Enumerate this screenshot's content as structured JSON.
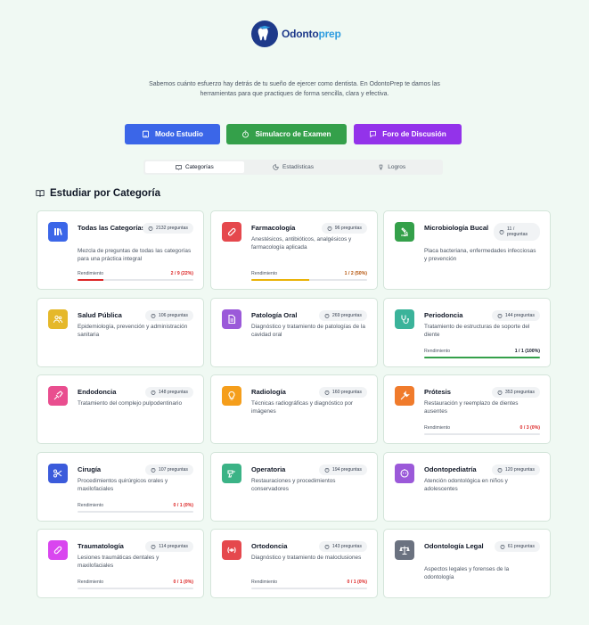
{
  "brand": {
    "name_main": "Odonto",
    "name_accent": "prep"
  },
  "tagline": "Sabemos cuánto esfuerzo hay detrás de tu sueño de ejercer como dentista. En OdontoPrep te damos las herramientas para que practiques de forma sencilla, clara y efectiva.",
  "modes": {
    "study": "Modo Estudio",
    "exam": "Simulacro de Examen",
    "forum": "Foro de Discusión"
  },
  "tabs": [
    {
      "label": "Categorías",
      "icon": "book-icon",
      "active": true
    },
    {
      "label": "Estadísticas",
      "icon": "chart-icon",
      "active": false
    },
    {
      "label": "Logros",
      "icon": "trophy-icon",
      "active": false
    }
  ],
  "section_title": "Estudiar por Categoría",
  "perf_label": "Rendimiento",
  "categories": [
    {
      "title": "Todas las Categorías",
      "badge": "2132 preguntas",
      "desc": "Mezcla de preguntas de todas las categorías para una práctica integral",
      "color": "#3b66e8",
      "icon": "library-icon",
      "perf": "2 / 9 (22%)",
      "pct": 22,
      "perf_color": "#dc2626",
      "bar_color": "#dc2626"
    },
    {
      "title": "Farmacología",
      "badge": "96 preguntas",
      "desc": "Anestésicos, antibióticos, analgésicos y farmacología aplicada",
      "color": "#e5484d",
      "icon": "pill-icon",
      "perf": "1 / 2 (50%)",
      "pct": 50,
      "perf_color": "#b45309",
      "bar_color": "#eab308"
    },
    {
      "title": "Microbiología Bucal",
      "badge": "11 / preguntas",
      "desc": "Placa bacteriana, enfermedades infecciosas y prevención",
      "color": "#34a04a",
      "icon": "microscope-icon"
    },
    {
      "title": "Salud Pública",
      "badge": "106 preguntas",
      "desc": "Epidemiología, prevención y administración sanitaria",
      "color": "#e5b82a",
      "icon": "users-icon"
    },
    {
      "title": "Patología Oral",
      "badge": "269 preguntas",
      "desc": "Diagnóstico y tratamiento de patologías de la cavidad oral",
      "color": "#9b59d9",
      "icon": "document-icon"
    },
    {
      "title": "Periodoncia",
      "badge": "144 preguntas",
      "desc": "Tratamiento de estructuras de soporte del diente",
      "color": "#3bb39a",
      "icon": "stethoscope-icon",
      "perf": "1 / 1 (100%)",
      "pct": 100,
      "perf_color": "#111827",
      "bar_color": "#34a04a"
    },
    {
      "title": "Endodoncia",
      "badge": "148 preguntas",
      "desc": "Tratamiento del complejo pulpodentinario",
      "color": "#e94e8f",
      "icon": "syringe-icon"
    },
    {
      "title": "Radiología",
      "badge": "160 preguntas",
      "desc": "Técnicas radiográficas y diagnóstico por imágenes",
      "color": "#f59e1b",
      "icon": "lightbulb-icon"
    },
    {
      "title": "Prótesis",
      "badge": "353 preguntas",
      "desc": "Restauración y reemplazo de dientes ausentes",
      "color": "#f07b2c",
      "icon": "wrench-icon",
      "perf": "0 / 3 (0%)",
      "pct": 0,
      "perf_color": "#dc2626",
      "bar_color": "#dc2626"
    },
    {
      "title": "Cirugía",
      "badge": "107 preguntas",
      "desc": "Procedimientos quirúrgicos orales y maxilofaciales",
      "color": "#3b5bdb",
      "icon": "scissors-icon",
      "perf": "0 / 1 (0%)",
      "pct": 0,
      "perf_color": "#dc2626",
      "bar_color": "#dc2626"
    },
    {
      "title": "Operatoria",
      "badge": "194 preguntas",
      "desc": "Restauraciones y procedimientos conservadores",
      "color": "#3bb386",
      "icon": "drill-icon"
    },
    {
      "title": "Odontopediatría",
      "badge": "120 preguntas",
      "desc": "Atención odontológica en niños y adolescentes",
      "color": "#9b59d9",
      "icon": "baby-icon"
    },
    {
      "title": "Traumatología",
      "badge": "114 preguntas",
      "desc": "Lesiones traumáticas dentales y maxilofaciales",
      "color": "#d946ef",
      "icon": "bandage-icon",
      "perf": "0 / 1 (0%)",
      "pct": 0,
      "perf_color": "#dc2626",
      "bar_color": "#dc2626"
    },
    {
      "title": "Ortodoncia",
      "badge": "143 preguntas",
      "desc": "Diagnóstico y tratamiento de maloclusiones",
      "color": "#e5484d",
      "icon": "brace-icon",
      "perf": "0 / 1 (0%)",
      "pct": 0,
      "perf_color": "#dc2626",
      "bar_color": "#dc2626"
    },
    {
      "title": "Odontología Legal",
      "badge": "61 preguntas",
      "desc": "Aspectos legales y forenses de la odontología",
      "color": "#6b7280",
      "icon": "scale-icon"
    }
  ]
}
